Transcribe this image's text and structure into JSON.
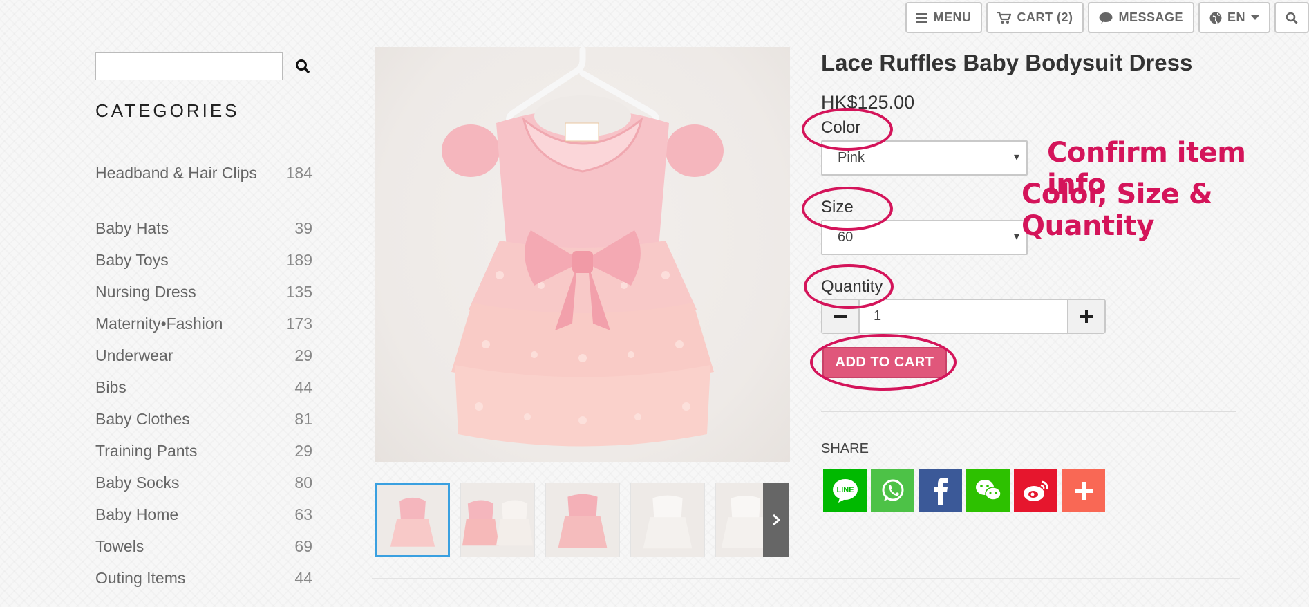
{
  "topnav": {
    "menu": "MENU",
    "cart": "CART (2)",
    "message": "MESSAGE",
    "language": "EN"
  },
  "sidebar": {
    "search_placeholder": "",
    "heading": "CATEGORIES",
    "categories": [
      {
        "name": "Headband & Hair Clips",
        "count": "184"
      },
      {
        "name": "Baby Hats",
        "count": "39"
      },
      {
        "name": "Baby Toys",
        "count": "189"
      },
      {
        "name": "Nursing Dress",
        "count": "135"
      },
      {
        "name": "Maternity•Fashion",
        "count": "173"
      },
      {
        "name": "Underwear",
        "count": "29"
      },
      {
        "name": "Bibs",
        "count": "44"
      },
      {
        "name": "Baby Clothes",
        "count": "81"
      },
      {
        "name": "Training Pants",
        "count": "29"
      },
      {
        "name": "Baby Socks",
        "count": "80"
      },
      {
        "name": "Baby Home",
        "count": "63"
      },
      {
        "name": "Towels",
        "count": "69"
      },
      {
        "name": "Outing Items",
        "count": "44"
      }
    ]
  },
  "product": {
    "title": "Lace Ruffles Baby Bodysuit Dress",
    "price": "HK$125.00",
    "color_label": "Color",
    "color_value": "Pink",
    "size_label": "Size",
    "size_value": "60",
    "quantity_label": "Quantity",
    "quantity_value": "1",
    "add_to_cart": "ADD TO CART",
    "share_label": "SHARE",
    "share_line_text": "LINE"
  },
  "annotation": {
    "line1": "Confirm item info",
    "line2": "Color, Size & Quantity"
  },
  "colors": {
    "accent": "#e0577b",
    "annotation": "#d4145a",
    "line": "#00b900",
    "whatsapp": "#4dc247",
    "facebook": "#3b5998",
    "wechat": "#2dc100",
    "weibo": "#e6162d",
    "more": "#f96855"
  }
}
